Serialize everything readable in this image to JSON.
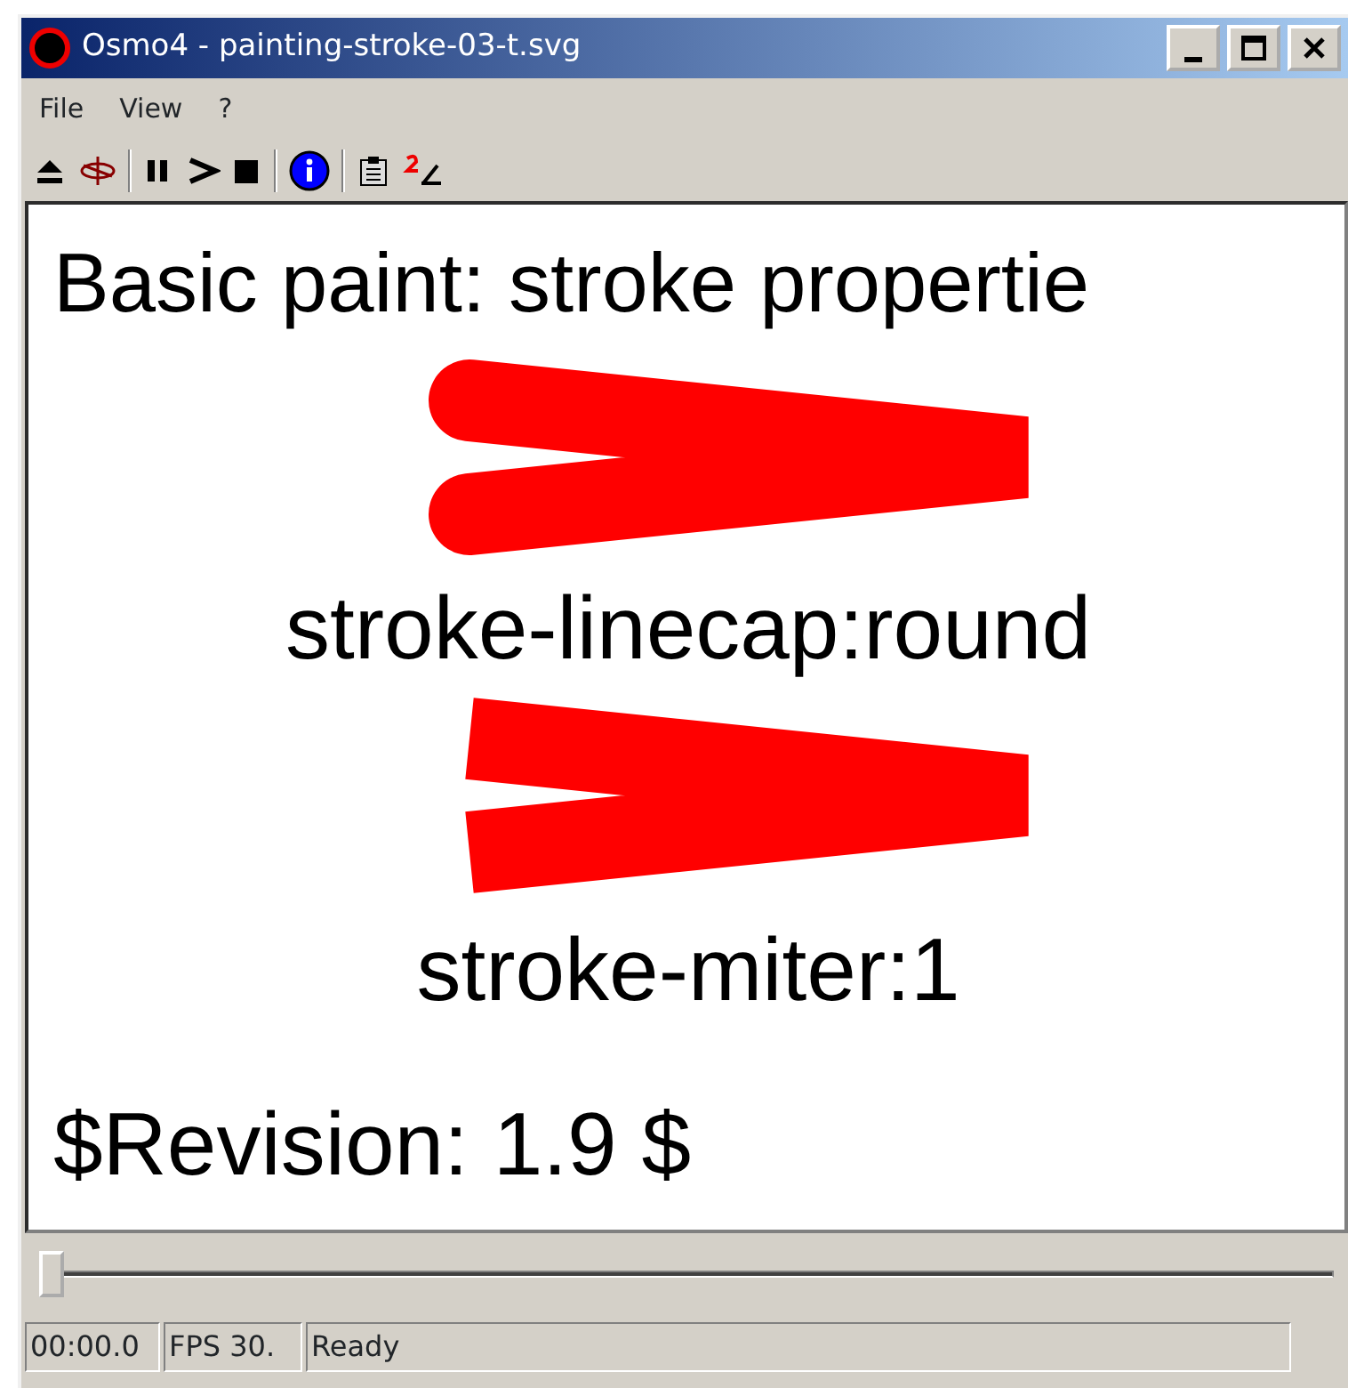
{
  "window": {
    "title": "Osmo4 - painting-stroke-03-t.svg"
  },
  "menu": [
    "File",
    "View",
    "?"
  ],
  "canvas": {
    "heading": "Basic paint: stroke propertie",
    "shapes": [
      {
        "kind": "round",
        "caption": "stroke-linecap:round"
      },
      {
        "kind": "butt",
        "caption": "stroke-miter:1"
      }
    ],
    "footer": "$Revision: 1.9 $"
  },
  "timeline": {
    "level": 0.0
  },
  "status_bar": [
    "00:00.0",
    "FPS 30.",
    "Ready"
  ]
}
